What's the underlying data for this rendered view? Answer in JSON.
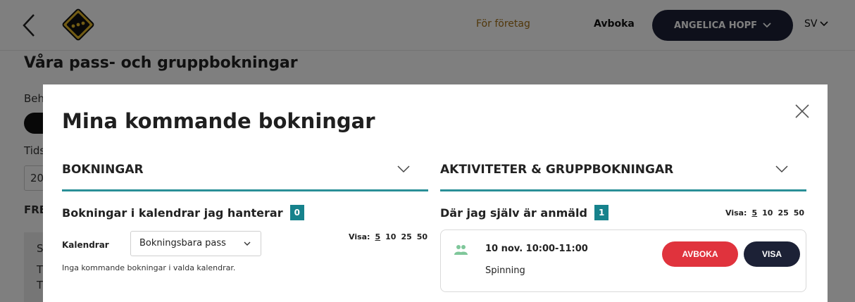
{
  "header": {
    "nav_business": "För företag",
    "nav_cancel": "Avboka",
    "user_name": "ANGELICA HOPF",
    "language": "SV"
  },
  "background_page": {
    "title": "Våra pass- och gruppbokningar",
    "fragment_1": "Beh",
    "fragment_2": "Tids",
    "input_fragment": "20",
    "fragment_3": "FRE",
    "box_line_1": "S",
    "box_line_2": "T",
    "box_line_3": "T"
  },
  "modal": {
    "title": "Mina kommande bokningar",
    "left": {
      "header": "BOKNINGAR",
      "subtitle": "Bokningar i kalendrar jag hanterar",
      "count": "0",
      "visa_label": "Visa:",
      "visa_options": [
        "5",
        "10",
        "25",
        "50"
      ],
      "calendar_label": "Kalendrar",
      "calendar_selected": "Bokningsbara pass",
      "empty_text": "Inga kommande bokningar i valda kalendrar."
    },
    "right": {
      "header": "AKTIVITETER & GRUPPBOKNINGAR",
      "subtitle": "Där jag själv är anmäld",
      "count": "1",
      "visa_label": "Visa:",
      "visa_options": [
        "5",
        "10",
        "25",
        "50"
      ],
      "bookings": [
        {
          "time": "10 nov. 10:00-11:00",
          "activity": "Spinning",
          "cancel_label": "AVBOKA",
          "view_label": "VISA"
        }
      ]
    }
  },
  "colors": {
    "accent_teal": "#16828c",
    "dark_navy": "#1c2136",
    "danger_red": "#e0333d",
    "gold": "#a26e14",
    "group_icon_green": "#7fc79a"
  },
  "icons": {
    "back": "chevron-left-icon",
    "logo": "club-logo",
    "user_dropdown": "chevron-down-icon",
    "language_dropdown": "chevron-down-icon",
    "close": "close-icon",
    "section_toggle": "chevron-down-icon",
    "booking_type": "group-icon"
  }
}
